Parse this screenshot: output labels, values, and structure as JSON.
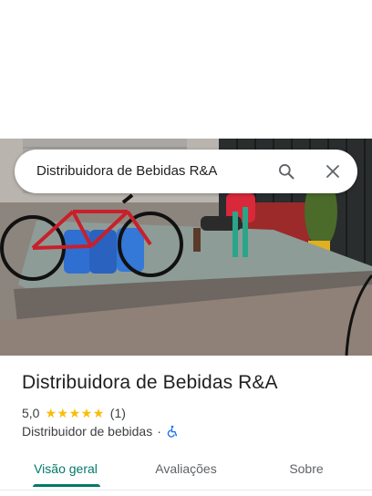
{
  "search": {
    "query": "Distribuidora de Bebidas R&A"
  },
  "icons": {
    "search": "search-icon",
    "close": "close-icon",
    "wheelchair": "wheelchair-accessible-icon"
  },
  "place": {
    "name": "Distribuidora de Bebidas R&A",
    "rating": "5,0",
    "stars": 5,
    "review_count": "(1)",
    "category": "Distribuidor de bebidas",
    "separator": "·"
  },
  "tabs": [
    {
      "label": "Visão geral",
      "active": true
    },
    {
      "label": "Avaliações",
      "active": false
    },
    {
      "label": "Sobre",
      "active": false
    }
  ],
  "colors": {
    "accent": "#00796b",
    "star": "#fbbc04"
  }
}
